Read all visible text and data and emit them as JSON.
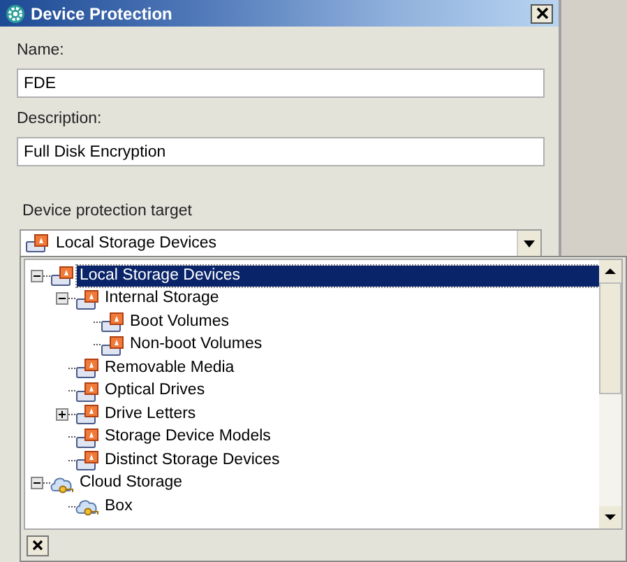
{
  "window": {
    "title": "Device Protection"
  },
  "fields": [
    {
      "label": "Name:",
      "value": "FDE"
    },
    {
      "label": "Description:",
      "value": "Full Disk Encryption"
    }
  ],
  "target": {
    "label": "Device protection target",
    "value": "Local Storage Devices",
    "tree": [
      {
        "label": "Local Storage Devices",
        "kind": "drive",
        "selected": true,
        "expanded": true,
        "children": [
          {
            "label": "Internal Storage",
            "kind": "drive",
            "selected": false,
            "expanded": true,
            "children": [
              {
                "label": "Boot Volumes",
                "kind": "drive",
                "selected": false
              },
              {
                "label": "Non-boot Volumes",
                "kind": "drive",
                "selected": false
              }
            ]
          },
          {
            "label": "Removable Media",
            "kind": "drive",
            "selected": false
          },
          {
            "label": "Optical Drives",
            "kind": "drive",
            "selected": false
          },
          {
            "label": "Drive Letters",
            "kind": "drive",
            "selected": false,
            "expanded": false
          },
          {
            "label": "Storage Device Models",
            "kind": "drive",
            "selected": false
          },
          {
            "label": "Distinct Storage Devices",
            "kind": "drive",
            "selected": false
          }
        ]
      },
      {
        "label": "Cloud Storage",
        "kind": "cloud",
        "selected": false,
        "expanded": true,
        "children": [
          {
            "label": "Box",
            "kind": "cloud",
            "selected": false
          }
        ]
      }
    ]
  }
}
